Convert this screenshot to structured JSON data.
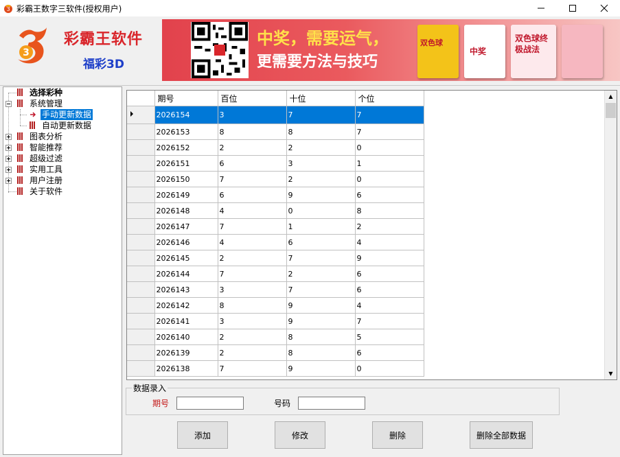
{
  "window": {
    "title": "彩霸王数字三软件(授权用户)"
  },
  "header": {
    "brand": "彩霸王软件",
    "subtitle": "福彩3D",
    "slogan_line1": "中奖，需要运气，",
    "slogan_line2": "更需要方法与技巧",
    "book1": "双色球",
    "book2": "中奖",
    "book3": "双色球终极战法"
  },
  "tree": {
    "items": [
      {
        "label": "选择彩种",
        "bold": true
      },
      {
        "label": "系统管理",
        "expanded": true
      },
      {
        "label": "手动更新数据",
        "selected": true
      },
      {
        "label": "自动更新数据"
      },
      {
        "label": "图表分析"
      },
      {
        "label": "智能推荐"
      },
      {
        "label": "超级过滤"
      },
      {
        "label": "实用工具"
      },
      {
        "label": "用户注册"
      },
      {
        "label": "关于软件"
      }
    ]
  },
  "grid": {
    "columns": [
      "期号",
      "百位",
      "十位",
      "个位"
    ],
    "rows": [
      [
        "2026154",
        "3",
        "7",
        "7"
      ],
      [
        "2026153",
        "8",
        "8",
        "7"
      ],
      [
        "2026152",
        "2",
        "2",
        "0"
      ],
      [
        "2026151",
        "6",
        "3",
        "1"
      ],
      [
        "2026150",
        "7",
        "2",
        "0"
      ],
      [
        "2026149",
        "6",
        "9",
        "6"
      ],
      [
        "2026148",
        "4",
        "0",
        "8"
      ],
      [
        "2026147",
        "7",
        "1",
        "2"
      ],
      [
        "2026146",
        "4",
        "6",
        "4"
      ],
      [
        "2026145",
        "2",
        "7",
        "9"
      ],
      [
        "2026144",
        "7",
        "2",
        "6"
      ],
      [
        "2026143",
        "3",
        "7",
        "6"
      ],
      [
        "2026142",
        "8",
        "9",
        "4"
      ],
      [
        "2026141",
        "3",
        "9",
        "7"
      ],
      [
        "2026140",
        "2",
        "8",
        "5"
      ],
      [
        "2026139",
        "2",
        "8",
        "6"
      ],
      [
        "2026138",
        "7",
        "9",
        "0"
      ]
    ],
    "selected_row": 0
  },
  "entry": {
    "legend": "数据录入",
    "period_label": "期号",
    "number_label": "号码",
    "period_value": "",
    "number_value": ""
  },
  "buttons": {
    "add": "添加",
    "edit": "修改",
    "delete": "删除",
    "delete_all": "删除全部数据"
  },
  "colors": {
    "selection": "#0078d7",
    "brand_red": "#d9262b",
    "subtitle_blue": "#1e3fc9"
  }
}
